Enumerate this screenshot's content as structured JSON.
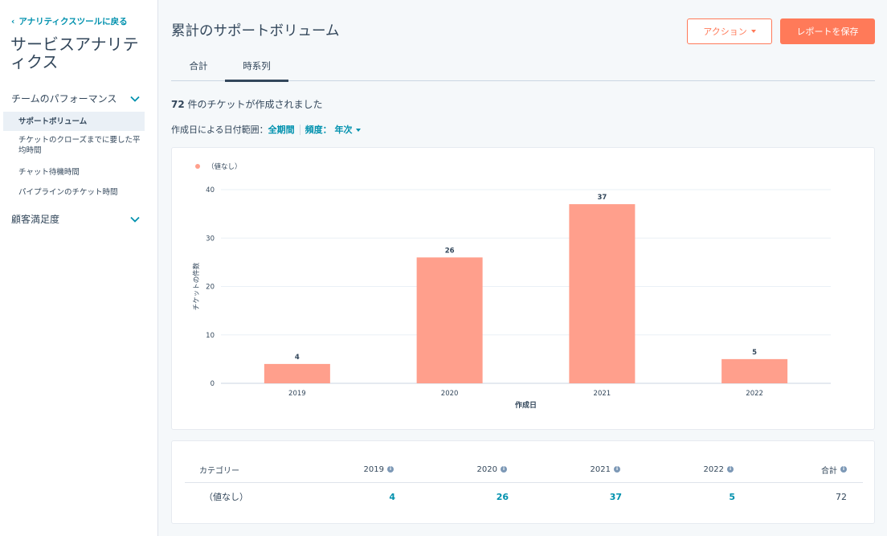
{
  "sidebar": {
    "back_link": "アナリティクスツールに戻る",
    "title": "サービスアナリティクス",
    "sections": [
      {
        "label": "チームのパフォーマンス",
        "items": [
          {
            "label": "サポートボリューム",
            "active": true
          },
          {
            "label": "チケットのクローズまでに要した平均時間",
            "active": false
          },
          {
            "label": "チャット待機時間",
            "active": false
          },
          {
            "label": "パイプラインのチケット時間",
            "active": false
          }
        ]
      },
      {
        "label": "顧客満足度",
        "items": []
      }
    ]
  },
  "header": {
    "title": "累計のサポートボリューム",
    "action_label": "アクション",
    "save_label": "レポートを保存"
  },
  "tabs": [
    {
      "label": "合計",
      "active": false
    },
    {
      "label": "時系列",
      "active": true
    }
  ],
  "summary": {
    "count": "72",
    "text": " 件のチケットが作成されました"
  },
  "filters": {
    "date_range_label": "作成日による日付範囲：",
    "date_range_value": "全期間",
    "frequency_label": "頻度：",
    "frequency_value": "年次"
  },
  "chart_data": {
    "type": "bar",
    "categories": [
      "2019",
      "2020",
      "2021",
      "2022"
    ],
    "series": [
      {
        "name": "（値なし）",
        "values": [
          4,
          26,
          37,
          5
        ]
      }
    ],
    "xlabel": "作成日",
    "ylabel": "チケットの件数",
    "ylim": [
      0,
      40
    ],
    "yticks": [
      0,
      10,
      20,
      30,
      40
    ],
    "grid": true,
    "legend": "top-left",
    "bar_color": "#ff9f8c"
  },
  "table": {
    "headers": [
      "カテゴリー",
      "2019",
      "2020",
      "2021",
      "2022",
      "合計"
    ],
    "rows": [
      {
        "category": "（値なし）",
        "values": [
          "4",
          "26",
          "37",
          "5"
        ],
        "total": "72"
      }
    ]
  },
  "colors": {
    "accent": "#ff7a59",
    "link": "#0091ae",
    "text": "#33475b"
  }
}
